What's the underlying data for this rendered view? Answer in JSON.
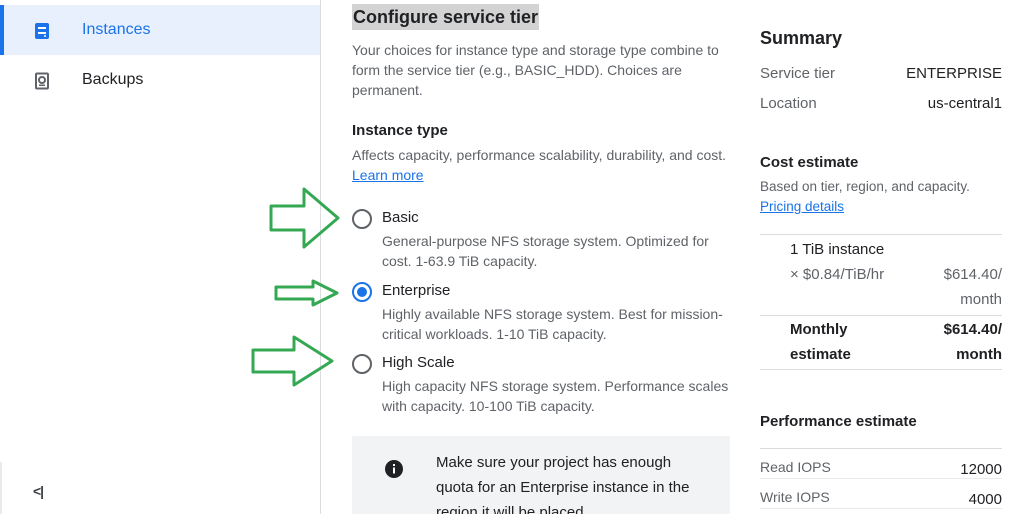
{
  "sidebar": {
    "items": [
      {
        "label": "Instances",
        "icon": "storage-instance-icon",
        "active": true
      },
      {
        "label": "Backups",
        "icon": "backup-icon",
        "active": false
      }
    ],
    "collapse_label": "<|",
    "collapse_icon": "collapse-sidebar-icon"
  },
  "main": {
    "title": "Configure service tier",
    "description": "Your choices for instance type and storage type combine to form the service tier (e.g., BASIC_HDD). Choices are permanent.",
    "instance_type": {
      "heading": "Instance type",
      "description": "Affects capacity, performance scalability, durability, and cost.",
      "learn_more": "Learn more",
      "options": [
        {
          "label": "Basic",
          "description": "General-purpose NFS storage system. Optimized for cost. 1-63.9 TiB capacity.",
          "checked": false
        },
        {
          "label": "Enterprise",
          "description": "Highly available NFS storage system. Best for mission-critical workloads. 1-10 TiB capacity.",
          "checked": true
        },
        {
          "label": "High Scale",
          "description": "High capacity NFS storage system. Performance scales with capacity. 10-100 TiB capacity.",
          "checked": false
        }
      ]
    },
    "info": {
      "icon": "info-icon",
      "text": "Make sure your project has enough quota for an Enterprise instance in the region it will be placed"
    }
  },
  "summary": {
    "title": "Summary",
    "rows": [
      {
        "key": "Service tier",
        "value": "ENTERPRISE"
      },
      {
        "key": "Location",
        "value": "us-central1"
      }
    ],
    "cost": {
      "title": "Cost estimate",
      "description": "Based on tier, region, and capacity.",
      "pricing_link": "Pricing details",
      "instance_label": "1 TiB instance",
      "rate": "× $0.84/TiB/hr",
      "instance_price": "$614.40/",
      "instance_unit": "month",
      "monthly_label_1": "Monthly",
      "monthly_label_2": "estimate",
      "monthly_price": "$614.40/",
      "monthly_unit": "month"
    },
    "performance": {
      "title": "Performance estimate",
      "rows": [
        {
          "key": "Read IOPS",
          "value": "12000"
        },
        {
          "key": "Write IOPS",
          "value": "4000"
        }
      ]
    }
  },
  "colors": {
    "accent": "#1a73e8",
    "annotation_arrow": "#34a853"
  }
}
